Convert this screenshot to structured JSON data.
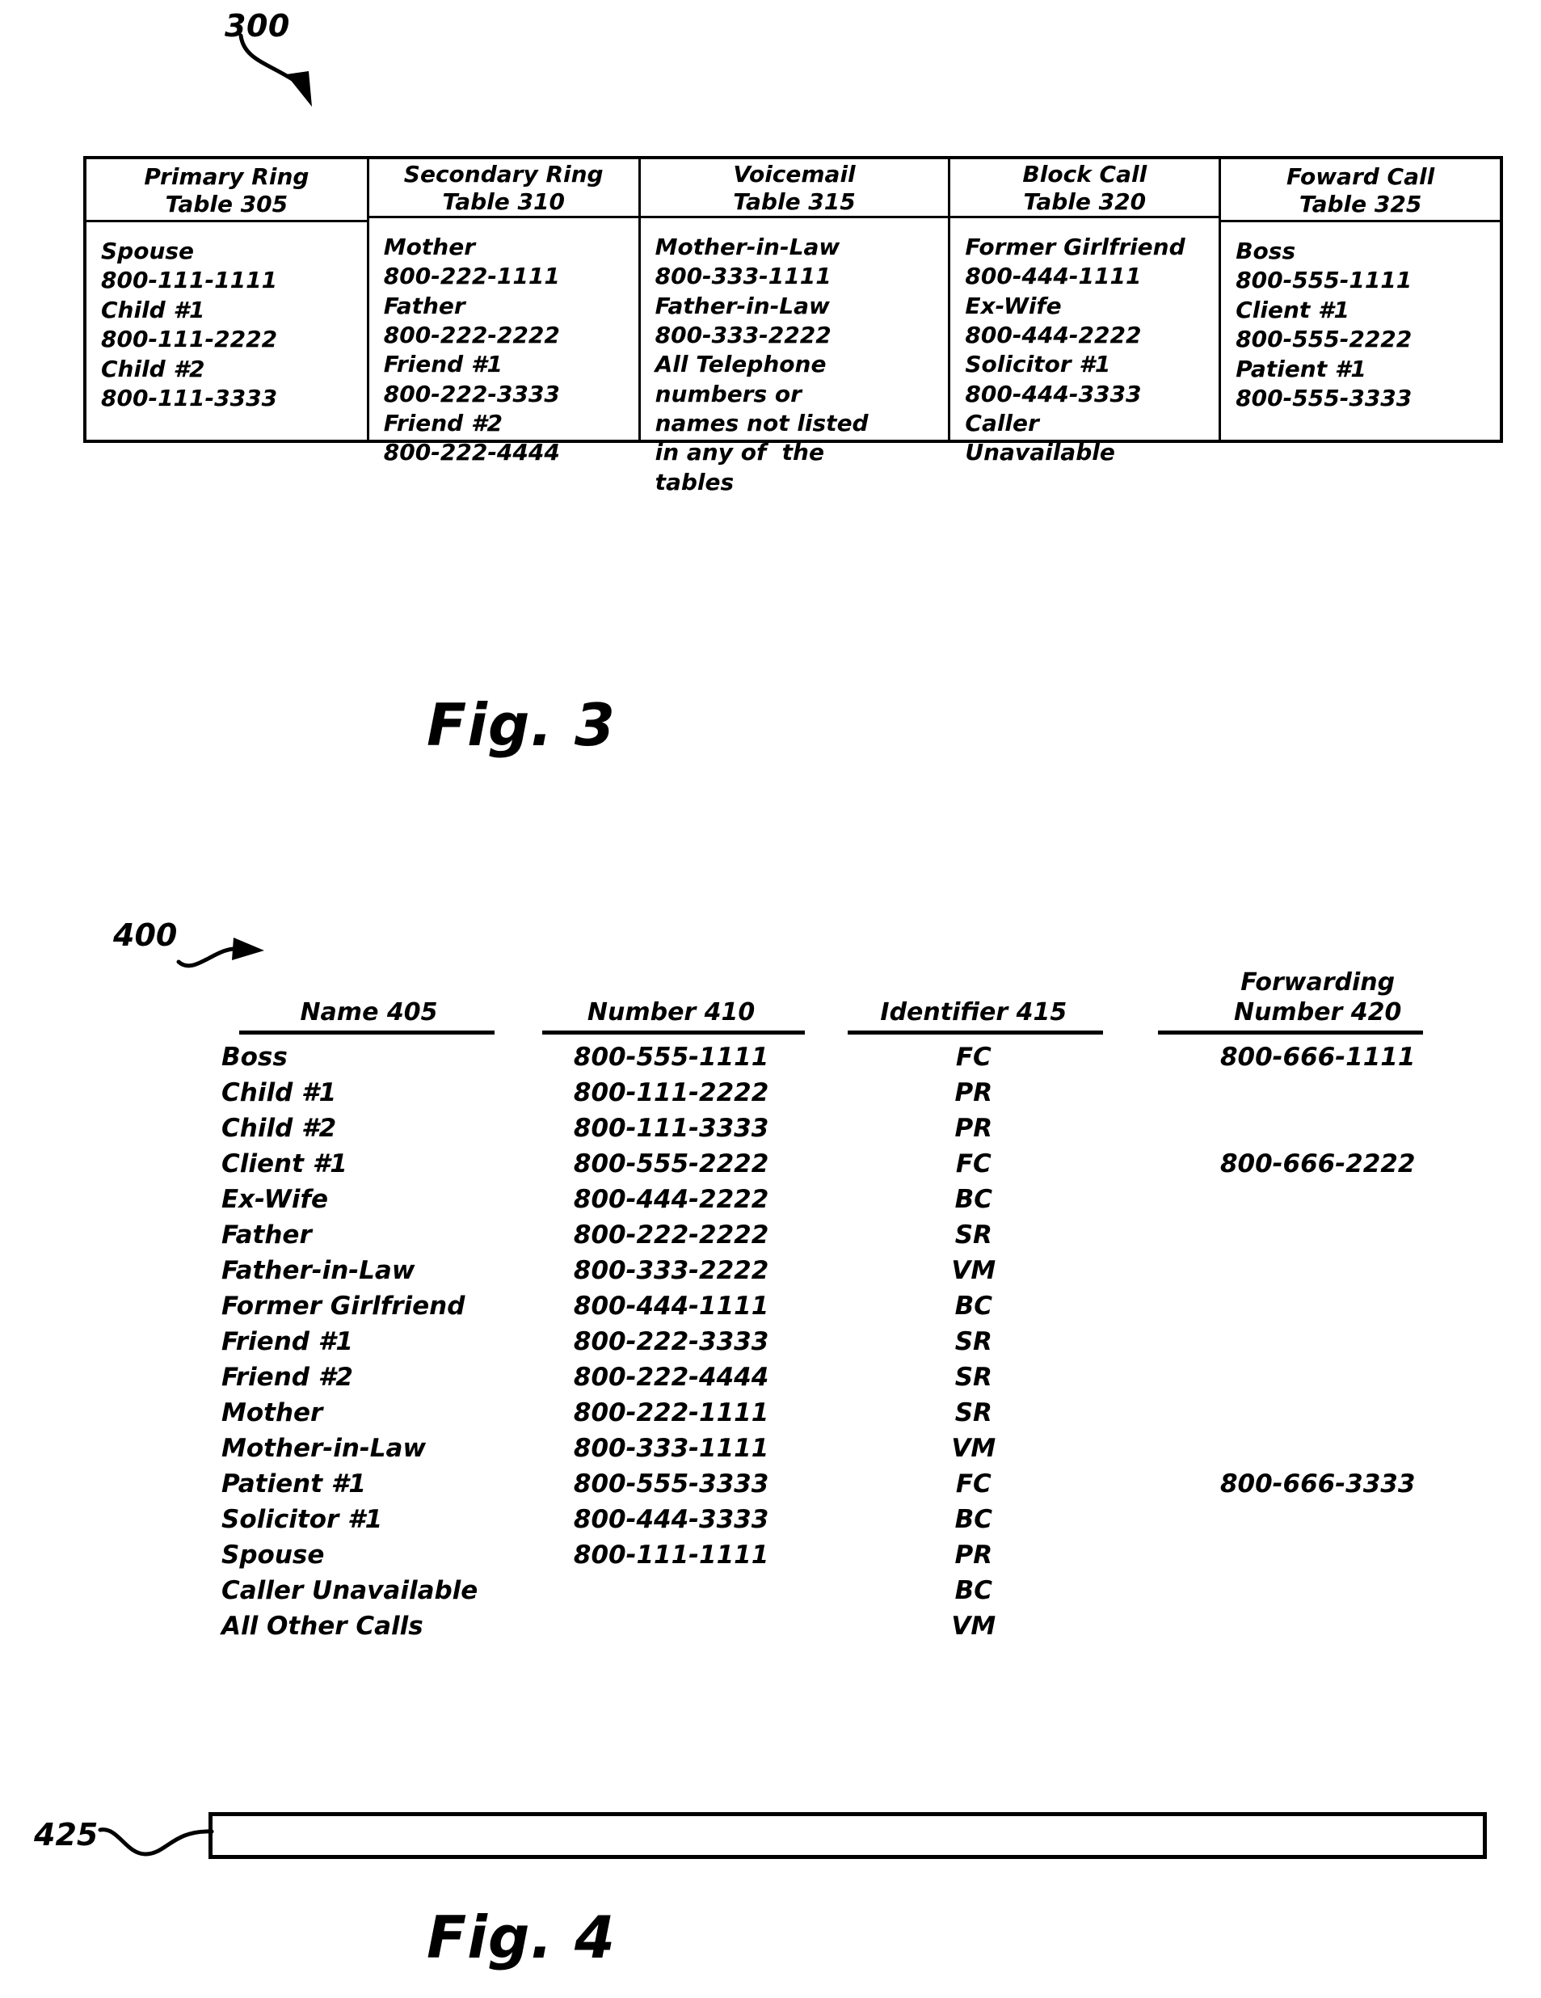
{
  "figure3": {
    "callout": "300",
    "caption": "Fig. 3",
    "columns": [
      {
        "header_line1": "Primary Ring",
        "header_line2": "Table 305",
        "entries": [
          "Spouse",
          "800-111-1111",
          "Child #1",
          "800-111-2222",
          "Child #2",
          "800-111-3333"
        ]
      },
      {
        "header_line1": "Secondary Ring",
        "header_line2": "Table 310",
        "entries": [
          "Mother",
          "800-222-1111",
          "Father",
          "800-222-2222",
          "Friend #1",
          "800-222-3333",
          "Friend #2",
          "800-222-4444"
        ]
      },
      {
        "header_line1": "Voicemail",
        "header_line2": "Table 315",
        "entries": [
          "Mother-in-Law",
          "800-333-1111",
          "Father-in-Law",
          "800-333-2222",
          "All Telephone",
          "numbers or",
          "names not listed",
          "in any of  the",
          "tables"
        ]
      },
      {
        "header_line1": "Block Call",
        "header_line2": "Table 320",
        "entries": [
          "Former Girlfriend",
          "800-444-1111",
          "Ex-Wife",
          "800-444-2222",
          "Solicitor #1",
          "800-444-3333",
          "Caller",
          "Unavailable"
        ]
      },
      {
        "header_line1": "Foward Call",
        "header_line2": "Table 325",
        "entries": [
          "Boss",
          "800-555-1111",
          "Client #1",
          "800-555-2222",
          "Patient #1",
          "800-555-3333"
        ]
      }
    ]
  },
  "figure4": {
    "callout": "400",
    "row_callout": "425",
    "caption": "Fig. 4",
    "headers": {
      "name": {
        "line1": "",
        "line2": "Name 405"
      },
      "number": {
        "line1": "",
        "line2": "Number 410"
      },
      "identifier": {
        "line1": "",
        "line2": "Identifier 415"
      },
      "forwarding": {
        "line1": "Forwarding",
        "line2": "Number 420"
      }
    },
    "rows": [
      {
        "name": "Boss",
        "number": "800-555-1111",
        "identifier": "FC",
        "forwarding": "800-666-1111",
        "highlighted": false
      },
      {
        "name": "Child #1",
        "number": "800-111-2222",
        "identifier": "PR",
        "forwarding": "",
        "highlighted": false
      },
      {
        "name": "Child #2",
        "number": "800-111-3333",
        "identifier": "PR",
        "forwarding": "",
        "highlighted": false
      },
      {
        "name": "Client #1",
        "number": "800-555-2222",
        "identifier": "FC",
        "forwarding": "800-666-2222",
        "highlighted": false
      },
      {
        "name": "Ex-Wife",
        "number": "800-444-2222",
        "identifier": "BC",
        "forwarding": "",
        "highlighted": false
      },
      {
        "name": "Father",
        "number": "800-222-2222",
        "identifier": "SR",
        "forwarding": "",
        "highlighted": false
      },
      {
        "name": "Father-in-Law",
        "number": "800-333-2222",
        "identifier": "VM",
        "forwarding": "",
        "highlighted": false
      },
      {
        "name": "Former Girlfriend",
        "number": "800-444-1111",
        "identifier": "BC",
        "forwarding": "",
        "highlighted": false
      },
      {
        "name": "Friend #1",
        "number": "800-222-3333",
        "identifier": "SR",
        "forwarding": "",
        "highlighted": false
      },
      {
        "name": "Friend #2",
        "number": "800-222-4444",
        "identifier": "SR",
        "forwarding": "",
        "highlighted": false
      },
      {
        "name": "Mother",
        "number": "800-222-1111",
        "identifier": "SR",
        "forwarding": "",
        "highlighted": false
      },
      {
        "name": "Mother-in-Law",
        "number": "800-333-1111",
        "identifier": "VM",
        "forwarding": "",
        "highlighted": false
      },
      {
        "name": "Patient #1",
        "number": "800-555-3333",
        "identifier": "FC",
        "forwarding": "800-666-3333",
        "highlighted": false
      },
      {
        "name": "Solicitor #1",
        "number": "800-444-3333",
        "identifier": "BC",
        "forwarding": "",
        "highlighted": false
      },
      {
        "name": "Spouse",
        "number": "800-111-1111",
        "identifier": "PR",
        "forwarding": "",
        "highlighted": true
      },
      {
        "name": "Caller Unavailable",
        "number": "",
        "identifier": "BC",
        "forwarding": "",
        "highlighted": false
      },
      {
        "name": "All Other Calls",
        "number": "",
        "identifier": "VM",
        "forwarding": "",
        "highlighted": false
      }
    ]
  },
  "colors": {
    "ink": "#000000",
    "page": "#ffffff"
  }
}
